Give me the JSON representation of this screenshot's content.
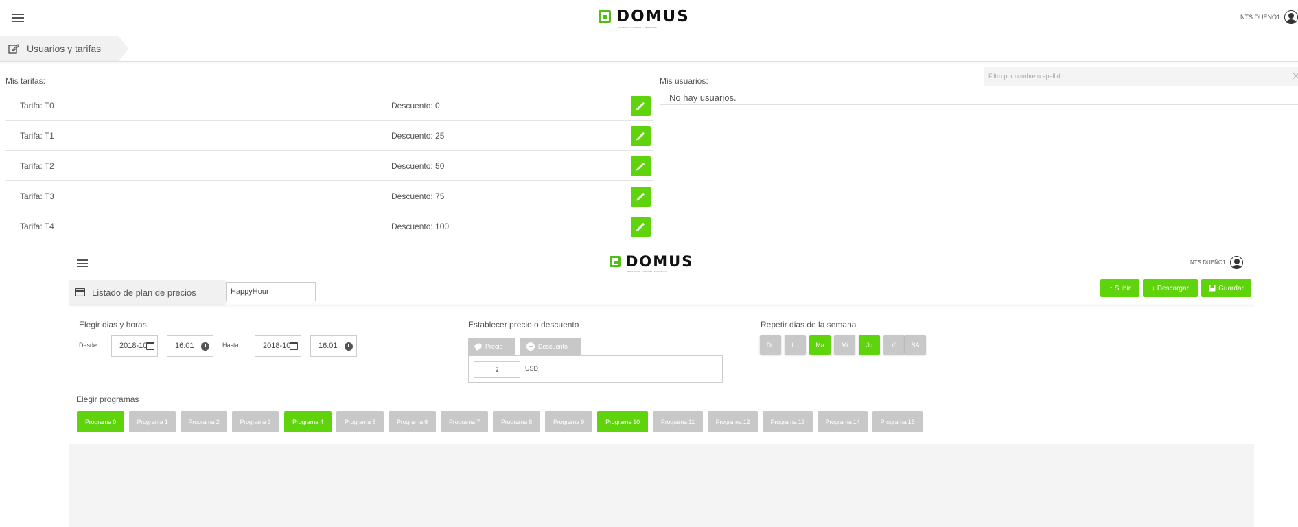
{
  "top": {
    "brand": "DOMUS",
    "brand_sub": "INNOVACION · CONFORT · SEGURIDAD",
    "user": "NTS DUEÑO1"
  },
  "crumb": {
    "title": "Usuarios y tarifas"
  },
  "tarifas": {
    "label": "Mis tarifas:",
    "rows": [
      {
        "name": "Tarifa: T0",
        "discount": "Descuento: 0"
      },
      {
        "name": "Tarifa: T1",
        "discount": "Descuento: 25"
      },
      {
        "name": "Tarifa: T2",
        "discount": "Descuento: 50"
      },
      {
        "name": "Tarifa: T3",
        "discount": "Descuento: 75"
      },
      {
        "name": "Tarifa: T4",
        "discount": "Descuento: 100"
      }
    ]
  },
  "usuarios": {
    "label": "Mis usuarios:",
    "empty": "No hay usuarios.",
    "filter_placeholder": "Filtro por nombre o apellido"
  },
  "inner": {
    "brand": "DOMUS",
    "brand_sub": "INNOVACION · CONFORT · SEGURIDAD",
    "user": "NTS DUEÑO1",
    "crumb_title": "Listado de plan de precios",
    "plan_name": "HappyHour",
    "btn_subir": "↑ Subir",
    "btn_descargar": "↓ Descargar",
    "btn_guardar": "Guardar",
    "dias_title": "Elegir dias y horas",
    "desde": "Desde",
    "hasta": "Hasta",
    "date_from": "2018-10",
    "time_from": "16:01",
    "date_to": "2018-10",
    "time_to": "16:01",
    "precio_title": "Establecer precio o descuento",
    "tab_precio": "Precio",
    "tab_descuento": "Descuento",
    "price_value": "2",
    "currency": "USD",
    "repeat_title": "Repetir dias de la semana",
    "days": [
      {
        "label": "Do",
        "on": false
      },
      {
        "label": "Lu",
        "on": false
      },
      {
        "label": "Ma",
        "on": true
      },
      {
        "label": "Mi",
        "on": false
      },
      {
        "label": "Ju",
        "on": true
      },
      {
        "label": "Vi",
        "on": false
      },
      {
        "label": "SÁ",
        "on": false
      }
    ],
    "programs_title": "Elegir programas",
    "programs": [
      {
        "label": "Programa 0",
        "on": true
      },
      {
        "label": "Programa 1",
        "on": false
      },
      {
        "label": "Programa 2",
        "on": false
      },
      {
        "label": "Programa 3",
        "on": false
      },
      {
        "label": "Programa 4",
        "on": true
      },
      {
        "label": "Programa 5",
        "on": false
      },
      {
        "label": "Programa 6",
        "on": false
      },
      {
        "label": "Programa 7",
        "on": false
      },
      {
        "label": "Programa 8",
        "on": false
      },
      {
        "label": "Programa 9",
        "on": false
      },
      {
        "label": "Programa 10",
        "on": true
      },
      {
        "label": "Programa 11",
        "on": false
      },
      {
        "label": "Programa 12",
        "on": false
      },
      {
        "label": "Programa 13",
        "on": false
      },
      {
        "label": "Programa 14",
        "on": false
      },
      {
        "label": "Programa 15",
        "on": false
      }
    ]
  },
  "colors": {
    "accent": "#5fd40c",
    "inactive": "#c8c8c8",
    "panel": "#f4f4f4"
  }
}
